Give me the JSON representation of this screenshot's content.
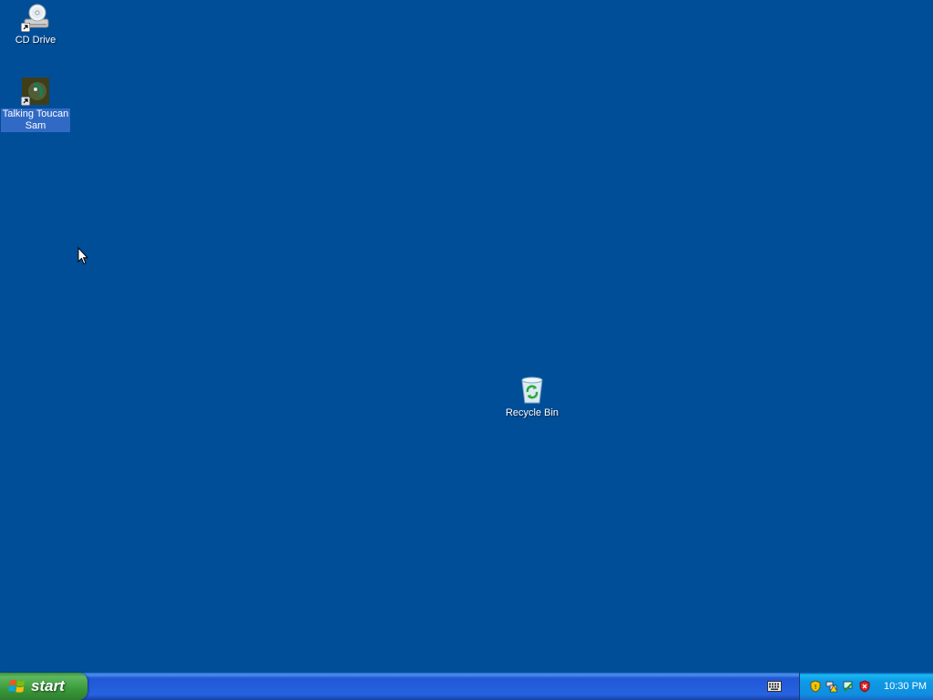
{
  "desktop": {
    "background_color": "#004e98",
    "icons": [
      {
        "label": "CD Drive",
        "icon": "cd-drive-icon",
        "shortcut": true,
        "selected": false
      },
      {
        "label": "Talking Toucan Sam",
        "icon": "toucan-app-icon",
        "shortcut": true,
        "selected": true
      },
      {
        "label": "Recycle Bin",
        "icon": "recycle-bin-icon",
        "shortcut": false,
        "selected": false
      }
    ]
  },
  "taskbar": {
    "start_label": "start",
    "start_icon": "windows-logo-icon",
    "quick_icons": [
      "keyboard-icon"
    ],
    "tray_icons": [
      "security-shield-icon",
      "network-warning-icon",
      "network-icon",
      "security-alert-icon"
    ],
    "clock": "10:30 PM"
  },
  "colors": {
    "desktop": "#004e98",
    "taskbar": "#2663e0",
    "start_green": "#3a9a3a",
    "tray": "#0f9ae6",
    "selection": "#316ac5"
  }
}
